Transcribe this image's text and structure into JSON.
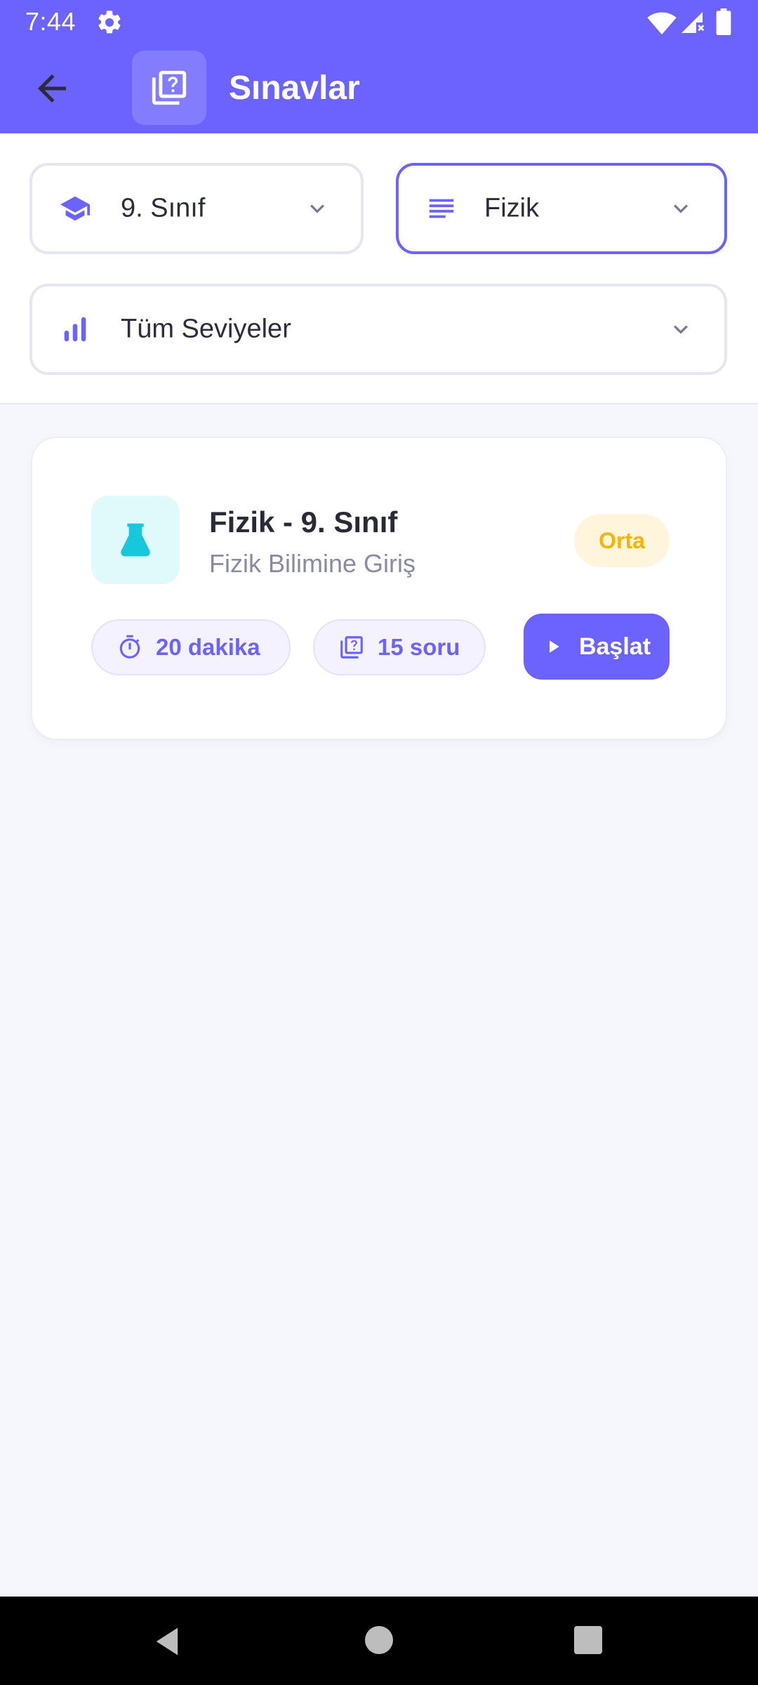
{
  "status_bar": {
    "time": "7:44",
    "icons": [
      "gear-icon",
      "wifi-icon",
      "signal-icon",
      "battery-icon"
    ]
  },
  "app_bar": {
    "title": "Sınavlar",
    "back_icon": "arrow-left-icon",
    "title_icon": "quiz-icon",
    "background": "#6C63FF"
  },
  "filters": {
    "class": {
      "label": "9. Sınıf",
      "icon": "school-cap-icon"
    },
    "subject": {
      "label": "Fizik",
      "icon": "subject-lines-icon",
      "active": true
    },
    "level": {
      "label": "Tüm Seviyeler",
      "icon": "bar-chart-icon"
    }
  },
  "exams": [
    {
      "title": "Fizik - 9. Sınıf",
      "subtitle": "Fizik Bilimine Giriş",
      "level": "Orta",
      "icon": "flask-icon",
      "duration": "20 dakika",
      "questions": "15 soru",
      "start_label": "Başlat"
    }
  ],
  "colors": {
    "primary": "#6C63FF",
    "badge_bg": "#FFF4DC",
    "badge_text": "#F5B400",
    "flask": "#17C7DB"
  },
  "nav_bar": {
    "icons": [
      "nav-back-icon",
      "nav-home-icon",
      "nav-recents-icon"
    ]
  }
}
